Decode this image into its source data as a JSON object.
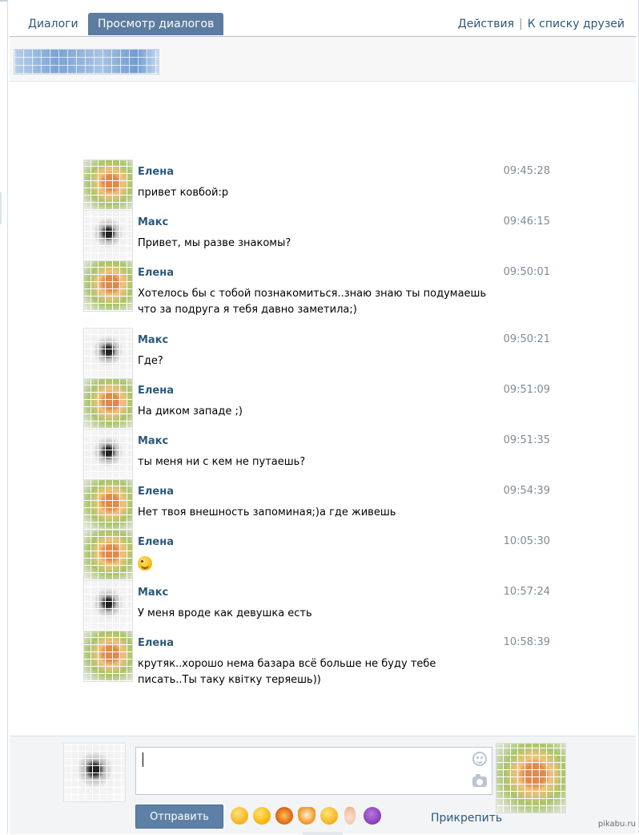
{
  "tabs": {
    "dialogs": "Диалоги",
    "view_dialogs": "Просмотр диалогов"
  },
  "header_actions": {
    "actions": "Действия",
    "separator": "|",
    "to_friends": "К списку друзей"
  },
  "messages": [
    {
      "author": "Елена",
      "time": "09:45:28",
      "text": "привет ковбой:р",
      "who": "elena"
    },
    {
      "author": "Макс",
      "time": "09:46:15",
      "text": "Привет, мы разве знакомы?",
      "who": "maks"
    },
    {
      "author": "Елена",
      "time": "09:50:01",
      "text": "Хотелось бы с тобой познакомиться..знаю знаю ты подумаешь что за подруга я тебя давно заметила;)",
      "who": "elena"
    },
    {
      "author": "Макс",
      "time": "09:50:21",
      "text": "Где?",
      "who": "maks"
    },
    {
      "author": "Елена",
      "time": "09:51:09",
      "text": "На диком западе ;)",
      "who": "elena"
    },
    {
      "author": "Макс",
      "time": "09:51:35",
      "text": "ты меня ни с кем не путаешь?",
      "who": "maks"
    },
    {
      "author": "Елена",
      "time": "09:54:39",
      "text": "Нет твоя внешность запоминая;)а где живешь",
      "who": "elena"
    },
    {
      "author": "Елена",
      "time": "10:05:30",
      "text": "",
      "emoji": "wink-emoji",
      "who": "elena"
    },
    {
      "author": "Макс",
      "time": "10:57:24",
      "text": "У меня вроде как девушка есть",
      "who": "maks"
    },
    {
      "author": "Елена",
      "time": "10:58:39",
      "text": "крутяк..хорошо нема базара всё больше не буду тебе писать..Ты таку квітку теряешь))",
      "who": "elena"
    }
  ],
  "composer": {
    "input_value": "",
    "send_label": "Отправить",
    "attach_label": "Прикрепить",
    "emoji_icons": [
      "smiling-cat-emoji",
      "blush-emoji",
      "tiger-emoji",
      "fox-emoji",
      "grinning-cat-emoji",
      "nose-emoji",
      "imp-emoji"
    ]
  },
  "watermark": "pikabu.ru",
  "colors": {
    "link": "#2b587a",
    "active_tab": "#5c7ca0",
    "send_button": "#5e80a6",
    "timestamp": "#808b96"
  }
}
